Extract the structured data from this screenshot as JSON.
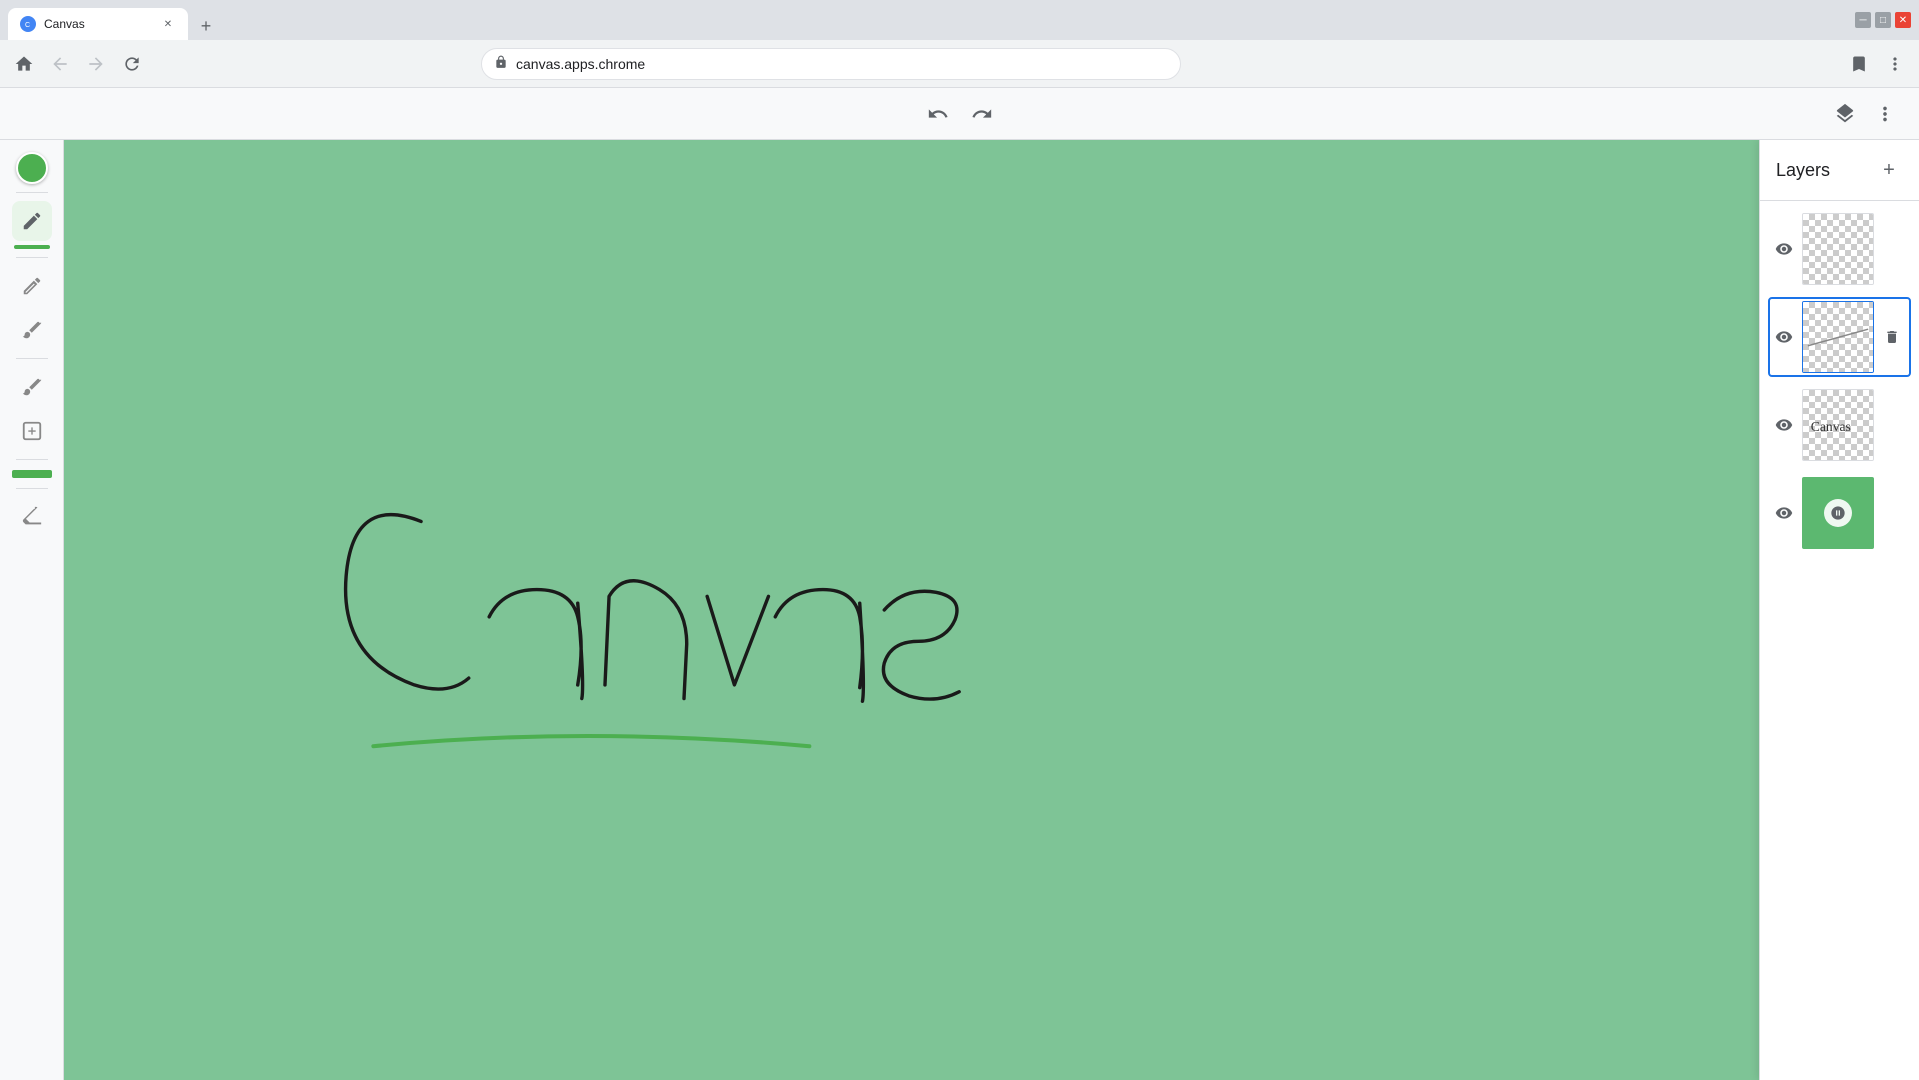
{
  "browser": {
    "tab_title": "Canvas",
    "tab_favicon_color": "#4285f4",
    "address": "canvas.apps.chrome",
    "new_tab_label": "+"
  },
  "toolbar": {
    "undo_label": "↩",
    "redo_label": "↪"
  },
  "layers_panel": {
    "title": "Layers",
    "add_button_label": "+",
    "layers": [
      {
        "id": 1,
        "visible": true,
        "selected": false,
        "type": "empty"
      },
      {
        "id": 2,
        "visible": true,
        "selected": true,
        "type": "line"
      },
      {
        "id": 3,
        "visible": true,
        "selected": false,
        "type": "text",
        "content": "Canvas"
      },
      {
        "id": 4,
        "visible": true,
        "selected": false,
        "type": "solid_green"
      }
    ]
  },
  "left_sidebar": {
    "color": "#4caf50",
    "tools": [
      "color-swatch",
      "pencil-tool",
      "pen-tool-1",
      "pen-tool-2",
      "pen-tool-3",
      "pen-tool-4",
      "eraser-tool"
    ]
  },
  "canvas": {
    "background_color": "#7ec496",
    "drawing_text": "Canvas"
  }
}
